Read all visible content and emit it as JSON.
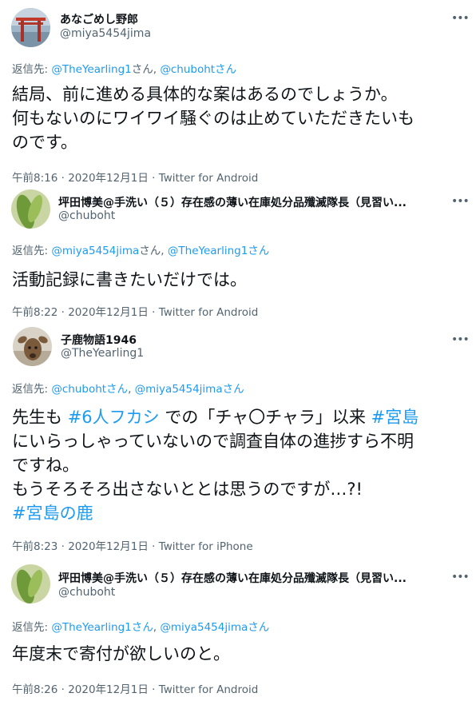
{
  "tweets": [
    {
      "name": "あなごめし野郎",
      "handle": "@miya5454jima",
      "more": "•••",
      "reply_prefix": "返信先: ",
      "mentions": [
        "@TheYearling1",
        "@chubohtさん"
      ],
      "mention_sep": "さん, ",
      "mention_suffix": "",
      "text_lines": [
        "結局、前に進める具体的な案はあるのでしょうか。",
        "何もないのにワイワイ騒ぐのは止めていただきたいも",
        "のです。"
      ],
      "time": "午前8:16",
      "date": "2020年12月1日",
      "source": "Twitter for Android"
    },
    {
      "name": "坪田博美@手洗い（５）存在感の薄い在庫処分品殲滅隊長（見習い...",
      "handle": "@chuboht",
      "more": "•••",
      "reply_prefix": "返信先: ",
      "mentions": [
        "@miya5454jima",
        "@TheYearling1さん"
      ],
      "mention_sep": "さん, ",
      "text_lines": [
        "活動記録に書きたいだけでは。"
      ],
      "time": "午前8:22",
      "date": "2020年12月1日",
      "source": "Twitter for Android"
    },
    {
      "name": "子鹿物語1946",
      "handle": "@TheYearling1",
      "more": "•••",
      "reply_prefix": "返信先: ",
      "mentions": [
        "@chubohtさん",
        "@miya5454jimaさん"
      ],
      "mention_sep": ", ",
      "text_parts": {
        "l1a": "先生も ",
        "tag1": "#6人フカシ",
        "l1b": " での「チャ〇チャラ」以来 ",
        "tag2": "#宮島",
        "l2": "にいらっしゃっていないので調査自体の進捗すら不明",
        "l3": "ですね。",
        "l4": "もうそろそろ出さないととは思うのですが…?!",
        "tag3": "#宮島の鹿"
      },
      "time": "午前8:23",
      "date": "2020年12月1日",
      "source": "Twitter for iPhone"
    },
    {
      "name": "坪田博美@手洗い（５）存在感の薄い在庫処分品殲滅隊長（見習い...",
      "handle": "@chuboht",
      "more": "•••",
      "reply_prefix": "返信先: ",
      "mentions": [
        "@TheYearling1さん",
        "@miya5454jimaさん"
      ],
      "mention_sep": ", ",
      "text_lines": [
        "年度末で寄付が欲しいのと。"
      ],
      "time": "午前8:26",
      "date": "2020年12月1日",
      "source": "Twitter for Android"
    }
  ],
  "meta_sep": " · ",
  "colors": {
    "link": "#1d9bf0",
    "secondary": "#536471",
    "text": "#0f1419"
  }
}
